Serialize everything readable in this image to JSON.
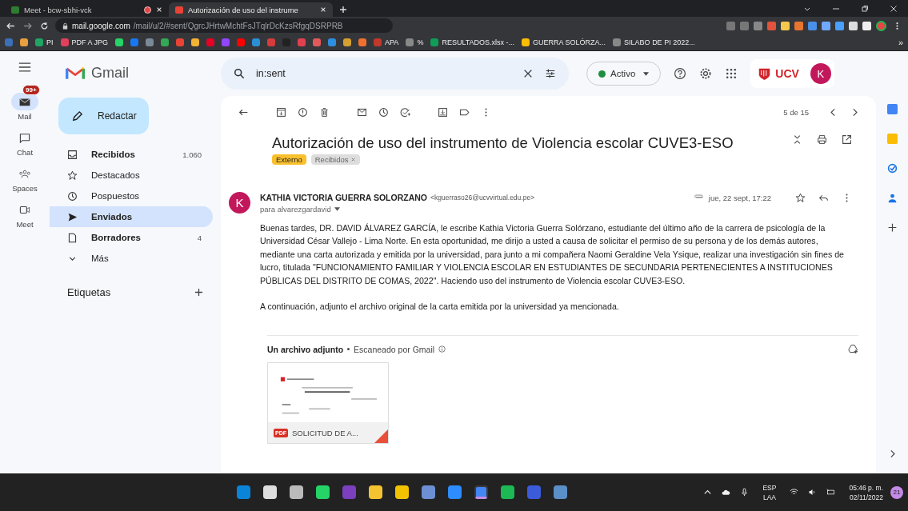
{
  "browser": {
    "tabs": [
      {
        "title": "Meet - bcw-sbhi-vck",
        "selected": false,
        "recording": true
      },
      {
        "title": "Autorización de uso del instrume",
        "selected": true,
        "recording": false
      }
    ],
    "url": {
      "host": "mail.google.com",
      "path": "/mail/u/2/#sent/QgrcJHrtwMchtFsJTqlrDcKzsRfgqDSRPRB"
    },
    "bookmarks": [
      {
        "color": "#3b6fb6"
      },
      {
        "color": "#e8a040"
      },
      {
        "label": "PI",
        "color": "#1fa463"
      },
      {
        "label": "PDF A JPG",
        "color": "#e0405a"
      },
      {
        "color": "#25d366"
      },
      {
        "color": "#1877f2"
      },
      {
        "color": "#7a8a99"
      },
      {
        "color": "#34a853"
      },
      {
        "color": "#ea4335"
      },
      {
        "color": "#f2b233"
      },
      {
        "color": "#e60023"
      },
      {
        "color": "#9146ff"
      },
      {
        "color": "#ff0000"
      },
      {
        "color": "#2b8fd8"
      },
      {
        "color": "#d63c3c"
      },
      {
        "color": "#222222"
      },
      {
        "color": "#e2404f"
      },
      {
        "color": "#e05a5a"
      },
      {
        "color": "#2d8fe0"
      },
      {
        "color": "#d4a030"
      },
      {
        "color": "#f07030"
      },
      {
        "label": "APA",
        "color": "#c0392b"
      },
      {
        "label": "%",
        "color": "#888888"
      },
      {
        "label": "RESULTADOS.xlsx -...",
        "color": "#0f9d58"
      },
      {
        "label": "GUERRA SOLÓRZA...",
        "color": "#fbbc04"
      },
      {
        "label": "SILABO DE PI 2022...",
        "color": "#888888"
      }
    ],
    "more": "»"
  },
  "gmail": {
    "rail": [
      {
        "label": "Mail",
        "selected": true,
        "badge": "99+"
      },
      {
        "label": "Chat",
        "selected": false
      },
      {
        "label": "Spaces",
        "selected": false
      },
      {
        "label": "Meet",
        "selected": false
      }
    ],
    "logo": "Gmail",
    "compose": "Redactar",
    "nav": [
      {
        "label": "Recibidos",
        "count": "1.060",
        "selected": false,
        "unread": true
      },
      {
        "label": "Destacados",
        "selected": false,
        "unread": false
      },
      {
        "label": "Pospuestos",
        "selected": false,
        "unread": false
      },
      {
        "label": "Enviados",
        "selected": true,
        "unread": true
      },
      {
        "label": "Borradores",
        "count": "4",
        "selected": false,
        "unread": true
      },
      {
        "label": "Más",
        "selected": false,
        "unread": false
      }
    ],
    "labels_heading": "Etiquetas",
    "search": {
      "value": "in:sent"
    },
    "status": "Activo",
    "org_logo": "UCV",
    "avatar": "K",
    "pager": "5 de 15",
    "message": {
      "subject": "Autorización de uso del instrumento de Violencia escolar CUVE3-ESO",
      "tags": [
        {
          "label": "Externo",
          "kind": "external"
        },
        {
          "label": "Recibidos",
          "kind": "label"
        }
      ],
      "avatar": "K",
      "sender": "KATHIA VICTORIA GUERRA SOLORZANO",
      "email": "<kguerraso26@ucvvirtual.edu.pe>",
      "to": "para alvarezgardavid",
      "date": "jue, 22 sept, 17:22",
      "starred": false,
      "body": [
        "Buenas tardes, DR. DAVID ÁLVAREZ GARCÍA, le escribe Kathia Victoria Guerra Solórzano, estudiante del último año de la carrera de psicología de la Universidad César Vallejo - Lima Norte. En esta oportunidad, me dirijo a usted a causa de solicitar el permiso de su persona y de los demás autores, mediante una carta autorizada y emitida por la universidad, para junto a mi compañera Naomi Geraldine Vela Ysique, realizar una investigación sin fines de lucro, titulada \"FUNCIONAMIENTO FAMILIAR Y VIOLENCIA ESCOLAR EN ESTUDIANTES DE SECUNDARIA PERTENECIENTES A INSTITUCIONES PÚBLICAS DEL DISTRITO DE COMAS, 2022\".  Haciendo uso del instrumento de Violencia escolar CUVE3-ESO.",
        "A continuación, adjunto el archivo original de la carta emitida por la universidad ya mencionada."
      ],
      "attachments_heading": "Un archivo adjunto",
      "scanned": "Escaneado por Gmail",
      "attachment": {
        "type_label": "PDF",
        "name": "SOLICITUD DE A..."
      }
    }
  },
  "taskbar": {
    "apps": [
      {
        "color": "#0a84d8",
        "active": false
      },
      {
        "color": "#dddddd",
        "active": false
      },
      {
        "color": "#bbbbbb",
        "active": false
      },
      {
        "color": "#25d366",
        "active": false
      },
      {
        "color": "#7b3fbf",
        "active": false
      },
      {
        "color": "#f4c430",
        "active": false
      },
      {
        "color": "#f2c200",
        "active": false
      },
      {
        "color": "#6d8fd4",
        "active": false
      },
      {
        "color": "#2d8cff",
        "active": false
      },
      {
        "color": "#4285f4",
        "active": true
      },
      {
        "color": "#1db954",
        "active": false
      },
      {
        "color": "#3b5bdb",
        "active": false
      },
      {
        "color": "#5a8fc8",
        "active": false
      }
    ],
    "lang": "ESP",
    "region": "LAA",
    "time": "05:46 p. m.",
    "date": "02/11/2022",
    "notifications": "21"
  }
}
